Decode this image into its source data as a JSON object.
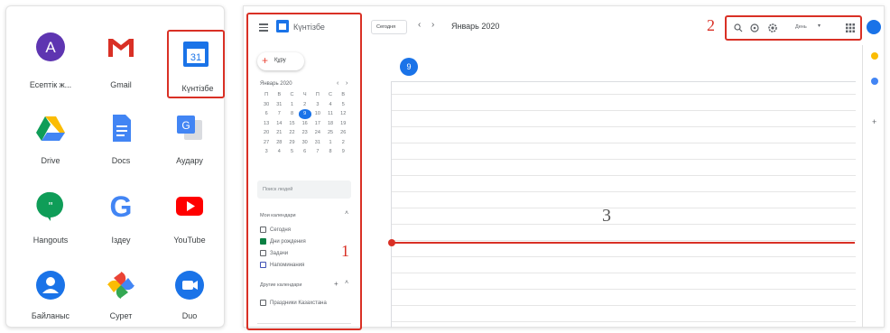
{
  "launcher": {
    "apps": [
      {
        "label": "Есептік ж...",
        "icon": "account-icon"
      },
      {
        "label": "Gmail",
        "icon": "gmail-icon"
      },
      {
        "label": "Күнтізбе",
        "icon": "calendar-icon",
        "icon_text": "31"
      },
      {
        "label": "Drive",
        "icon": "drive-icon"
      },
      {
        "label": "Docs",
        "icon": "docs-icon"
      },
      {
        "label": "Аудару",
        "icon": "translate-icon"
      },
      {
        "label": "Hangouts",
        "icon": "hangouts-icon"
      },
      {
        "label": "Іздеу",
        "icon": "google-search-icon",
        "icon_text": "G"
      },
      {
        "label": "YouTube",
        "icon": "youtube-icon"
      },
      {
        "label": "Байланыс",
        "icon": "contacts-icon"
      },
      {
        "label": "Сурет",
        "icon": "photos-icon"
      },
      {
        "label": "Duo",
        "icon": "duo-icon"
      }
    ],
    "avatar_letter": "A"
  },
  "calendar": {
    "app_title": "Күнтізбе",
    "create_label": "Құру",
    "today_button": "Сегодня",
    "period_title": "Январь 2020",
    "view_select": "День",
    "day_number": "9",
    "mini_month_title": "Январь 2020",
    "search_people_placeholder": "Поиск людей",
    "my_calendars_title": "Мои календари",
    "my_calendars": [
      {
        "label": "Сегодня",
        "checked": false
      },
      {
        "label": "Дни рождения",
        "checked": true
      },
      {
        "label": "Задачи",
        "checked": false
      },
      {
        "label": "Напоминания",
        "checked": false
      }
    ],
    "other_calendars_title": "Другие календари",
    "other_calendars": [
      {
        "label": "Праздники Казахстана",
        "checked": false
      }
    ]
  },
  "callouts": {
    "one": "1",
    "two": "2",
    "three": "3"
  },
  "colors": {
    "highlight": "#d93025",
    "google_blue": "#1a73e8",
    "now_line": "#d93025"
  }
}
